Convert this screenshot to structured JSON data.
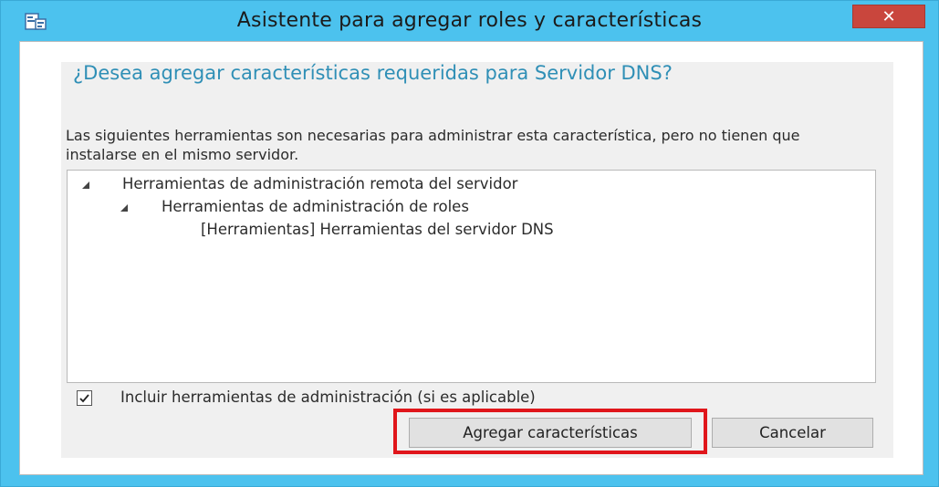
{
  "window": {
    "title": "Asistente para agregar roles y características",
    "close_glyph": "✕"
  },
  "dialog": {
    "heading": "¿Desea agregar características requeridas para Servidor DNS?",
    "description": "Las siguientes herramientas son necesarias para administrar esta característica, pero no tienen que instalarse en el mismo servidor.",
    "tree": [
      {
        "label": "Herramientas de administración remota del servidor",
        "level": 0,
        "expanded": true
      },
      {
        "label": "Herramientas de administración de roles",
        "level": 1,
        "expanded": true
      },
      {
        "label": "[Herramientas] Herramientas del servidor DNS",
        "level": 2,
        "expanded": false
      }
    ],
    "include_tools": {
      "checked": true,
      "label": "Incluir herramientas de administración (si es aplicable)"
    },
    "buttons": {
      "add_label": "Agregar características",
      "cancel_label": "Cancelar"
    }
  },
  "colors": {
    "frame": "#4cc2ee",
    "heading": "#2f8fb6",
    "close": "#c9463d",
    "highlight": "#e0161b"
  },
  "icons": {
    "app": "wizard-app-icon",
    "close": "close-icon",
    "expand": "tree-expanded-arrow-icon",
    "check": "checkmark-icon"
  }
}
